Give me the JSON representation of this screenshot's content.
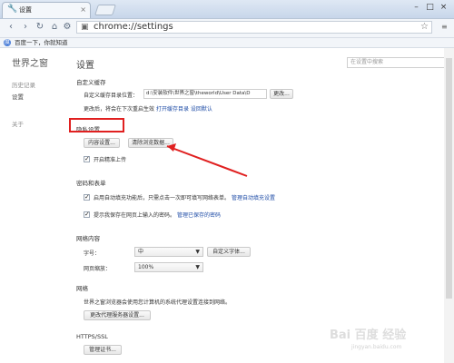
{
  "browser": {
    "tab_title": "设置",
    "window_controls": [
      "–",
      "□",
      "×"
    ],
    "url": "chrome://settings",
    "bookmark_label": "百度一下，你就知道"
  },
  "sidebar": {
    "title": "世界之窗",
    "items": [
      {
        "label": "历史记录"
      },
      {
        "label": "设置"
      },
      {
        "label": "关于"
      }
    ]
  },
  "main": {
    "title": "设置",
    "search_placeholder": "在设置中搜索",
    "custom_cache": {
      "title": "自定义缓存",
      "label": "自定义缓存目录位置：",
      "path": "d:\\安装软件\\世界之窗\\theworld\\User Data\\D",
      "change_button": "更改...",
      "note_prefix": "更改后，将会在下次重启生效",
      "note_link1": "打开缓存目录",
      "note_link2": "设回默认"
    },
    "privacy": {
      "title": "隐私设置",
      "content_button": "内容设置...",
      "clear_button": "清除浏览数据...",
      "checkbox_label": "开启精准上传"
    },
    "passwords_forms": {
      "title": "密码和表单",
      "autofill_label": "启用自动填充功能后，只需点击一次即可填写网络表单。",
      "autofill_link": "管理自动填充设置",
      "save_password_label": "提示我保存在网页上输入的密码。",
      "save_password_link": "管理已保存的密码"
    },
    "web_content": {
      "title": "网络内容",
      "font_size_label": "字号：",
      "font_size_value": "中",
      "customize_fonts_button": "自定义字体...",
      "zoom_label": "网页缩放：",
      "zoom_value": "100%"
    },
    "network": {
      "title": "网络",
      "description": "世界之窗浏览器会使用您计算机的系统代理设置连接到网络。",
      "proxy_button": "更改代理服务器设置..."
    },
    "https": {
      "title": "HTTPS/SSL",
      "cert_button": "管理证书..."
    }
  },
  "watermark": {
    "brand": "Bai 百度 经验",
    "url": "jingyan.baidu.com"
  },
  "colors": {
    "accent_link": "#1e4ca6",
    "highlight_red": "#e02020"
  }
}
